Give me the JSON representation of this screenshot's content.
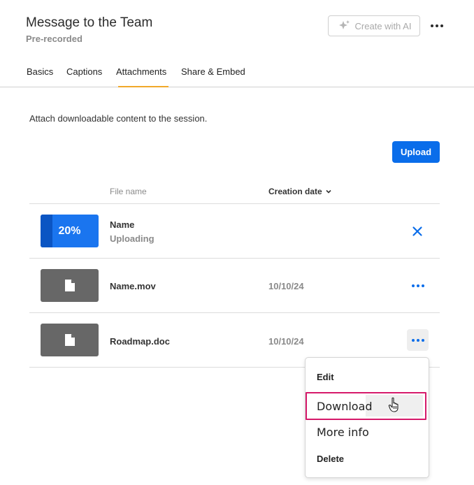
{
  "header": {
    "title": "Message to the Team",
    "subtitle": "Pre-recorded",
    "ai_button_label": "Create with AI"
  },
  "tabs": [
    {
      "label": "Basics",
      "active": false
    },
    {
      "label": "Captions",
      "active": false
    },
    {
      "label": "Attachments",
      "active": true
    },
    {
      "label": "Share & Embed",
      "active": false
    }
  ],
  "attachments": {
    "description": "Attach downloadable content to the session.",
    "upload_label": "Upload",
    "columns": {
      "file_name": "File name",
      "creation_date": "Creation date"
    },
    "rows": [
      {
        "name": "Name",
        "status": "Uploading",
        "progress_label": "20%",
        "progress": 0.2,
        "date": ""
      },
      {
        "name": "Name.mov",
        "status": "",
        "date": "10/10/24"
      },
      {
        "name": "Roadmap.doc",
        "status": "",
        "date": "10/10/24"
      }
    ]
  },
  "context_menu": {
    "items": [
      "Edit",
      "Download",
      "More info",
      "Delete"
    ],
    "highlighted": "Download"
  },
  "colors": {
    "accent": "#0a6dea",
    "tab_underline": "#f0a92a",
    "highlight_border": "#d6196a",
    "thumbnail": "#676767"
  }
}
